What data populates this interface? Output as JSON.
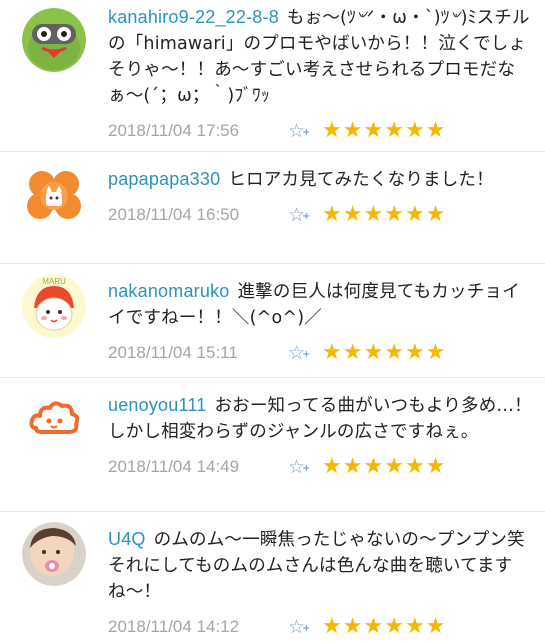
{
  "comments": [
    {
      "username": "kanahiro9-22_22-8-8",
      "text": "もぉ〜(ﾂ৺ᐟ・ω・`)ﾂ৺)ﾐスチルの「himawari」のプロモやばいから！！泣くでしょそりゃ〜！！あ〜すごい考えさせられるプロモだなぁ〜(´；ω；｀)ﾌﾞﾜｯ",
      "timestamp": "2018/11/04 17:56",
      "avatar_icon": "green-robot-avatar-icon",
      "stars": 6
    },
    {
      "username": "papapapa330",
      "text": "ヒロアカ見てみたくなりました！",
      "timestamp": "2018/11/04 16:50",
      "avatar_icon": "orange-flower-cat-avatar-icon",
      "stars": 6
    },
    {
      "username": "nakanomaruko",
      "text": "進撃の巨人は何度見てもカッチョイイですねー！！＼(^o^)／",
      "timestamp": "2018/11/04 15:11",
      "avatar_icon": "maru-character-avatar-icon",
      "avatar_text": "MARU",
      "stars": 6
    },
    {
      "username": "uenoyou111",
      "text": "おおー知ってる曲がいつもより多め…！しかし相変わらずのジャンルの広さですねぇ。",
      "timestamp": "2018/11/04 14:49",
      "avatar_icon": "orange-cloud-avatar-icon",
      "stars": 6
    },
    {
      "username": "U4Q",
      "text": "のムのム〜一瞬焦ったじゃないの〜プンプン笑それにしてものムのムさんは色んな曲を聴いてますね〜！",
      "timestamp": "2018/11/04 14:12",
      "avatar_icon": "baby-photo-avatar-icon",
      "stars": 6
    }
  ],
  "star_glyph": "★",
  "add_star_glyph": "☆",
  "add_star_plus": "+",
  "colors": {
    "username": "#2a93c2",
    "star": "#f4b800",
    "timestamp": "#a5a5a5"
  }
}
